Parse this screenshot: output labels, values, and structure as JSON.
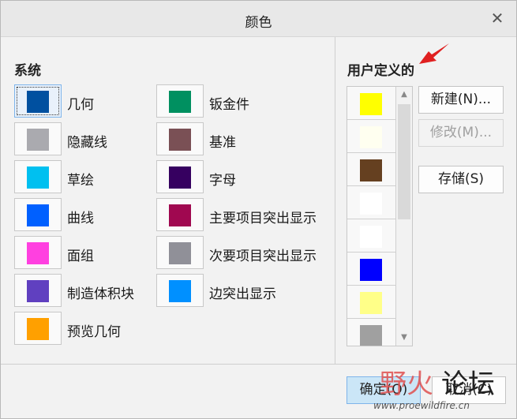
{
  "window": {
    "title": "颜色",
    "close_glyph": "✕"
  },
  "system": {
    "label": "系统",
    "left_column": [
      {
        "label": "几何",
        "color": "#0050A0",
        "selected": true
      },
      {
        "label": "隐藏线",
        "color": "#AAAAAF"
      },
      {
        "label": "草绘",
        "color": "#00C0F0"
      },
      {
        "label": "曲线",
        "color": "#0060FF"
      },
      {
        "label": "面组",
        "color": "#FF40E0"
      },
      {
        "label": "制造体积块",
        "color": "#6040C0"
      },
      {
        "label": "预览几何",
        "color": "#FFA000"
      }
    ],
    "right_column": [
      {
        "label": "钣金件",
        "color": "#009060"
      },
      {
        "label": "基准",
        "color": "#7A5055"
      },
      {
        "label": "字母",
        "color": "#360060"
      },
      {
        "label": "主要项目突出显示",
        "color": "#A00850"
      },
      {
        "label": "次要项目突出显示",
        "color": "#909098"
      },
      {
        "label": "边突出显示",
        "color": "#0090FF"
      }
    ]
  },
  "user_defined": {
    "label": "用户定义的",
    "swatches": [
      {
        "color": "#FFFF00"
      },
      {
        "color": "#FFFFF0"
      },
      {
        "color": "#654020"
      },
      {
        "color": "#FFFFFF"
      },
      {
        "color": "#FFFFFF"
      },
      {
        "color": "#0000FF"
      },
      {
        "color": "#FFFF88"
      },
      {
        "color": "#A0A0A0"
      }
    ],
    "scroll_up_glyph": "▲",
    "scroll_down_glyph": "▼",
    "buttons": {
      "new": "新建(N)...",
      "modify": "修改(M)...",
      "save": "存储(S)"
    }
  },
  "footer": {
    "ok": "确定(O)",
    "cancel": "取消(C)"
  },
  "watermark": {
    "line1": "野火",
    "line2": "论坛",
    "url": "www.proewildfire.cn"
  },
  "accent_color": "#7EB4EA",
  "annotation_arrow_color": "#E02020"
}
